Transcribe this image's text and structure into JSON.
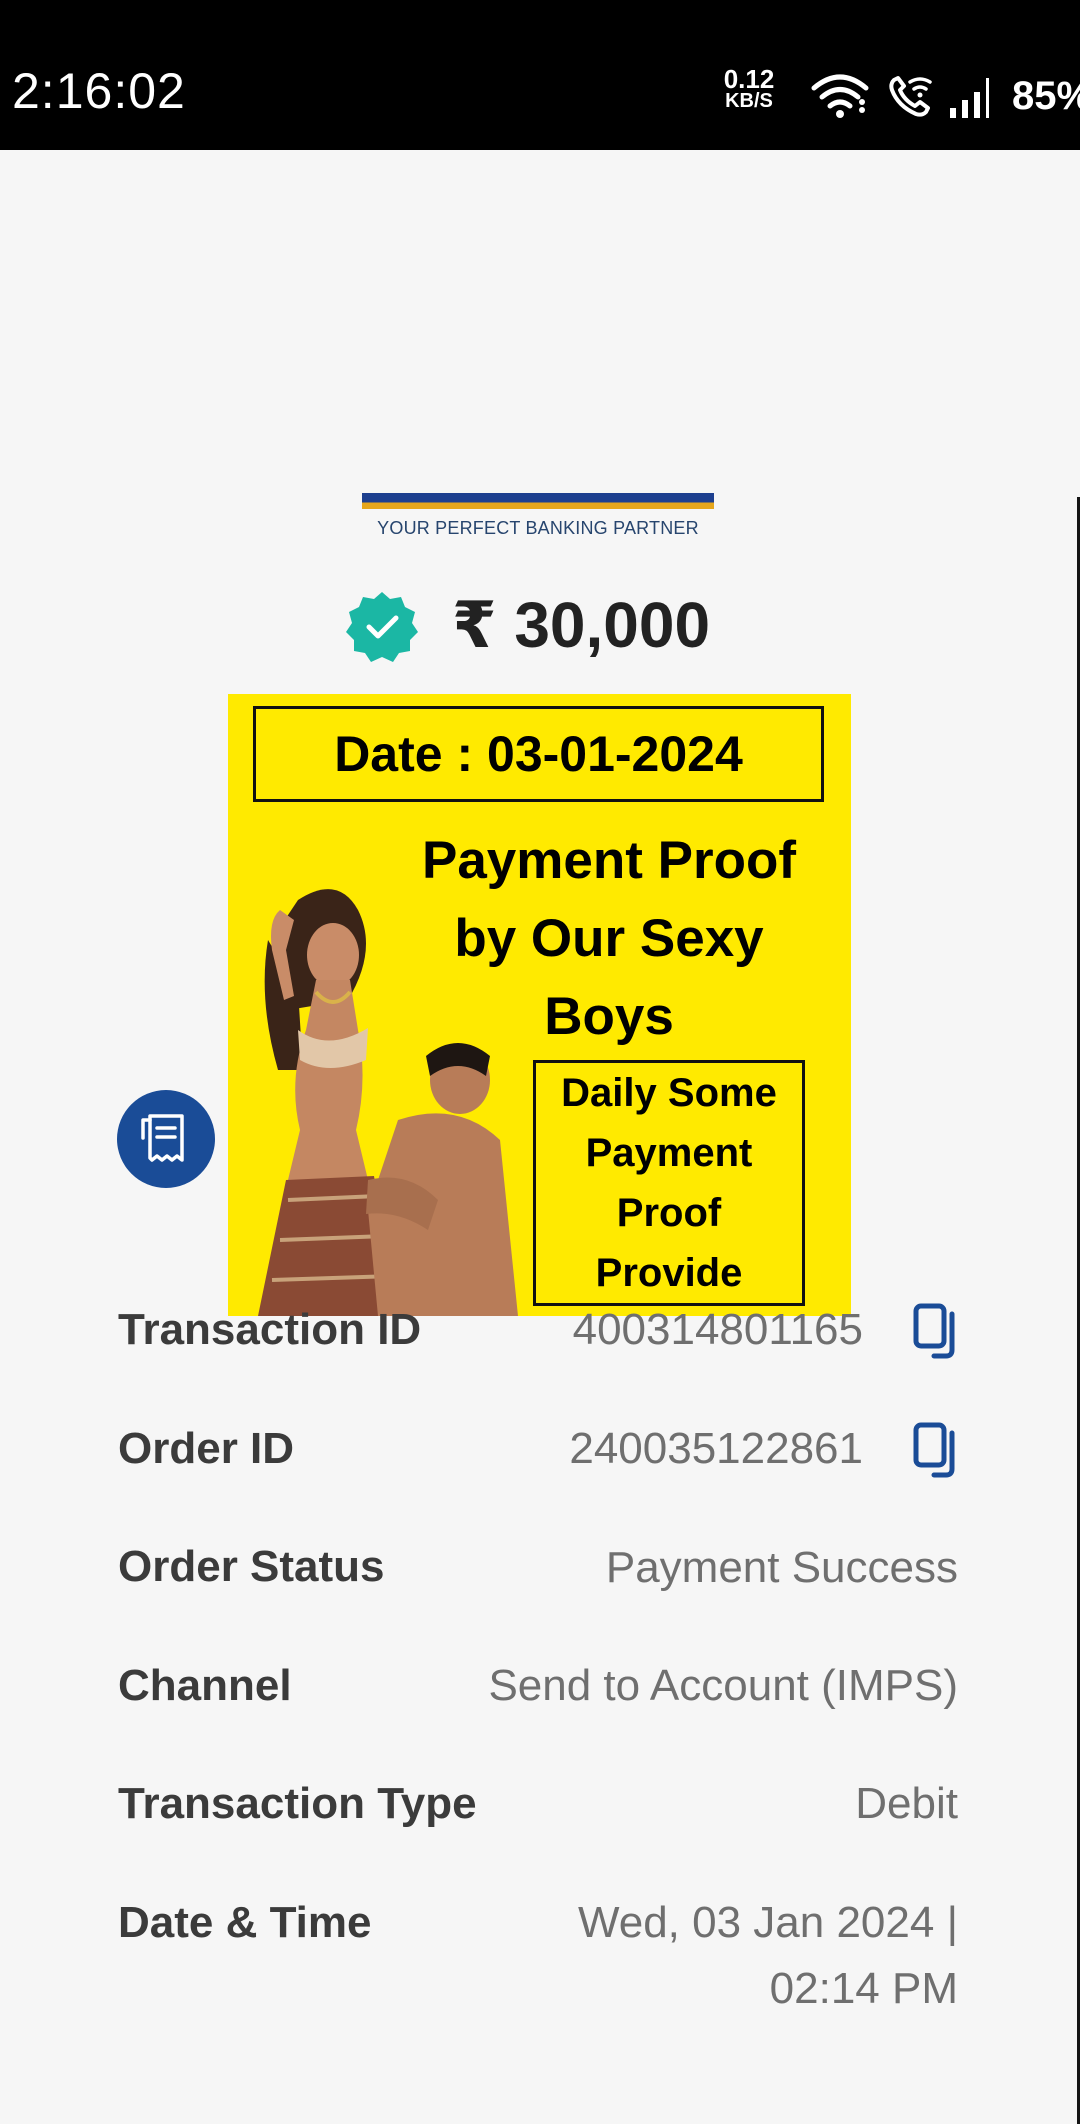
{
  "status_bar": {
    "time": "2:16:02",
    "net_speed_value": "0.12",
    "net_speed_unit": "KB/S",
    "battery": "85%",
    "icons": [
      "wifi-icon",
      "wifi-calling-icon",
      "signal-icon"
    ]
  },
  "header": {
    "tagline": "YOUR PERFECT BANKING PARTNER",
    "bank_colors": [
      "#1d3f8f",
      "#e6a61c"
    ]
  },
  "payment": {
    "amount": "₹ 30,000",
    "status_icon": "verified-check-icon",
    "accent": "#1bb7a4"
  },
  "promo": {
    "date": "Date : 03-01-2024",
    "headline": [
      "Payment Proof",
      "by Our Sexy",
      "Boys"
    ],
    "box_lines": [
      "Daily Some",
      "Payment",
      "Proof",
      "Provide"
    ],
    "background": "#ffea00"
  },
  "details": {
    "transaction_id": {
      "label": "Transaction ID",
      "value": "400314801165"
    },
    "order_id": {
      "label": "Order ID",
      "value": "240035122861"
    },
    "order_status": {
      "label": "Order Status",
      "value": "Payment Success"
    },
    "channel": {
      "label": "Channel",
      "value": "Send to Account (IMPS)"
    },
    "transaction_type": {
      "label": "Transaction Type",
      "value": "Debit"
    },
    "date_time": {
      "label": "Date & Time",
      "value_line1": "Wed, 03 Jan 2024 |",
      "value_line2": "02:14 PM"
    }
  }
}
